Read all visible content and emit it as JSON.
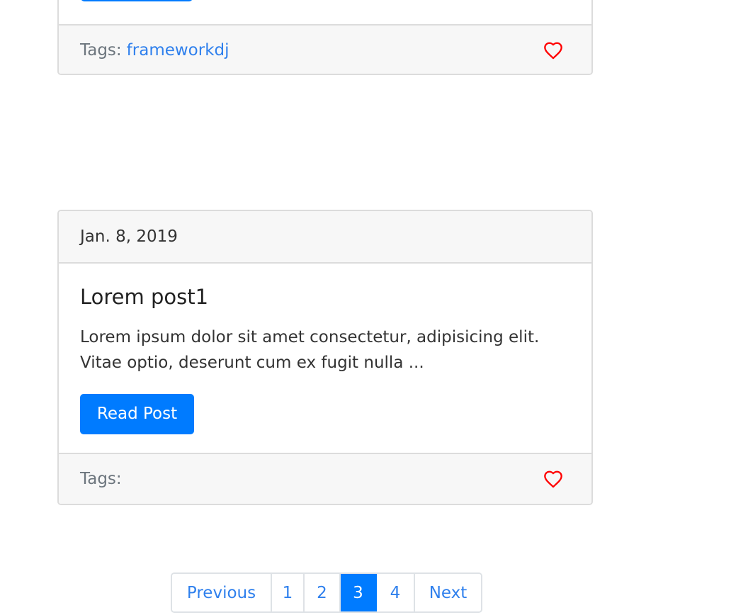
{
  "posts": [
    {
      "tags_label": "Tags:",
      "tags": [
        "frameworkdj"
      ]
    },
    {
      "date": "Jan. 8, 2019",
      "title": "Lorem post1",
      "excerpt": "Lorem ipsum dolor sit amet consectetur, adipisicing elit. Vitae optio, deserunt cum ex fugit nulla ...",
      "read_label": "Read Post",
      "tags_label": "Tags:",
      "tags": []
    }
  ],
  "pagination": {
    "previous_label": "Previous",
    "pages": [
      "1",
      "2",
      "3",
      "4"
    ],
    "active_page": "3",
    "next_label": "Next"
  },
  "colors": {
    "primary": "#007bff",
    "link": "#2f80ed",
    "heart": "#ff0000"
  },
  "icons": {
    "like": "heart-outline-icon"
  }
}
